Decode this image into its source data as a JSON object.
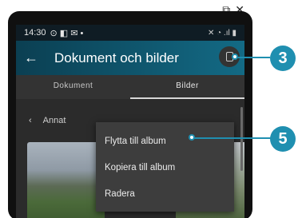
{
  "window_controls": {
    "popout_icon": "popout-icon",
    "close_label": "✕"
  },
  "status_bar": {
    "time": "14:30",
    "icons_left": "⊙ ◧ ✉ •",
    "icons_right": "✕ ◔ .ıl ▮"
  },
  "app_bar": {
    "title": "Dokument och bilder",
    "back_glyph": "←"
  },
  "tabs": [
    {
      "label": "Dokument"
    },
    {
      "label": "Bilder"
    }
  ],
  "folder": {
    "back_glyph": "‹",
    "name": "Annat"
  },
  "context_menu": {
    "items": [
      {
        "label": "Flytta till album"
      },
      {
        "label": "Kopiera till album"
      },
      {
        "label": "Radera"
      }
    ]
  },
  "callouts": [
    {
      "number": "3"
    },
    {
      "number": "5"
    }
  ],
  "colors": {
    "accent": "#1f8fb0",
    "appbar": "#0f4f66"
  }
}
